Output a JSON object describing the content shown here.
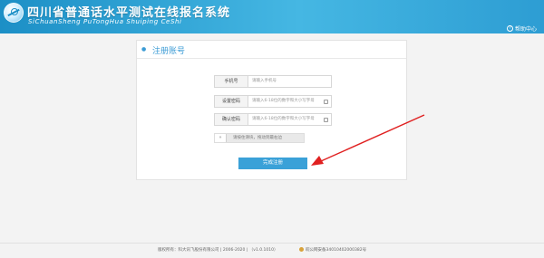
{
  "header": {
    "title": "四川省普通话水平测试在线报名系统",
    "subtitle": "SiChuanSheng PuTongHua Shuiping CeShi",
    "help_label": "帮助中心",
    "help_icon": "?"
  },
  "card": {
    "title": "注册账号",
    "fields": [
      {
        "label": "手机号",
        "placeholder": "请输入手机号"
      },
      {
        "label": "设置密码",
        "placeholder": "请输入6-18位的数字和大小写字母"
      },
      {
        "label": "确认密码",
        "placeholder": "请输入6-18位的数字和大小写字母"
      }
    ],
    "slider": {
      "handle": "»",
      "text": "请按住滑块，拖动到最右边"
    },
    "submit_label": "完成注册"
  },
  "footer": {
    "copyright": "版权所有：科大讯飞股份有限公司 | 2006-2020 | （v1.0.1010）",
    "record": "皖公网安备34010402000382号"
  },
  "colors": {
    "header_start": "#1c8fc6",
    "accent": "#3b9bd5",
    "button": "#3aa1d8",
    "arrow": "#e02020"
  }
}
